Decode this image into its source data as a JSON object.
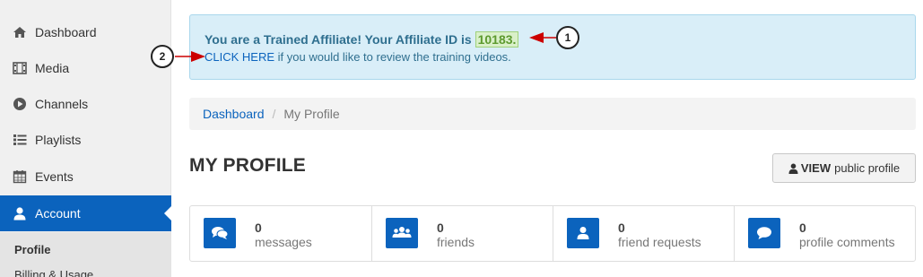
{
  "sidebar": {
    "items": [
      {
        "label": "Dashboard",
        "icon": "home-icon"
      },
      {
        "label": "Media",
        "icon": "film-icon"
      },
      {
        "label": "Channels",
        "icon": "play-circle-icon"
      },
      {
        "label": "Playlists",
        "icon": "list-icon"
      },
      {
        "label": "Events",
        "icon": "calendar-icon"
      },
      {
        "label": "Account",
        "icon": "user-icon"
      }
    ],
    "sub_items": [
      {
        "label": "Profile"
      },
      {
        "label": "Billing & Usage"
      }
    ]
  },
  "alert": {
    "prefix": "You are a Trained Affiliate! Your Affiliate ID is",
    "affiliate_id": "10183.",
    "link_text": "CLICK HERE",
    "suffix": "if you would like to review the training videos."
  },
  "callouts": [
    "1",
    "2"
  ],
  "breadcrumb": {
    "home": "Dashboard",
    "separator": "/",
    "current": "My Profile"
  },
  "page": {
    "title": "MY PROFILE",
    "view_bold": "VIEW",
    "view_rest": "public profile"
  },
  "stats": [
    {
      "value": "0",
      "label": "messages",
      "icon": "comments-icon"
    },
    {
      "value": "0",
      "label": "friends",
      "icon": "users-icon"
    },
    {
      "value": "0",
      "label": "friend requests",
      "icon": "user-icon"
    },
    {
      "value": "0",
      "label": "profile comments",
      "icon": "comment-icon"
    }
  ],
  "colors": {
    "accent": "#0b63bd",
    "alert_bg": "#d9eef8",
    "annotation_arrow": "#cc0000"
  }
}
